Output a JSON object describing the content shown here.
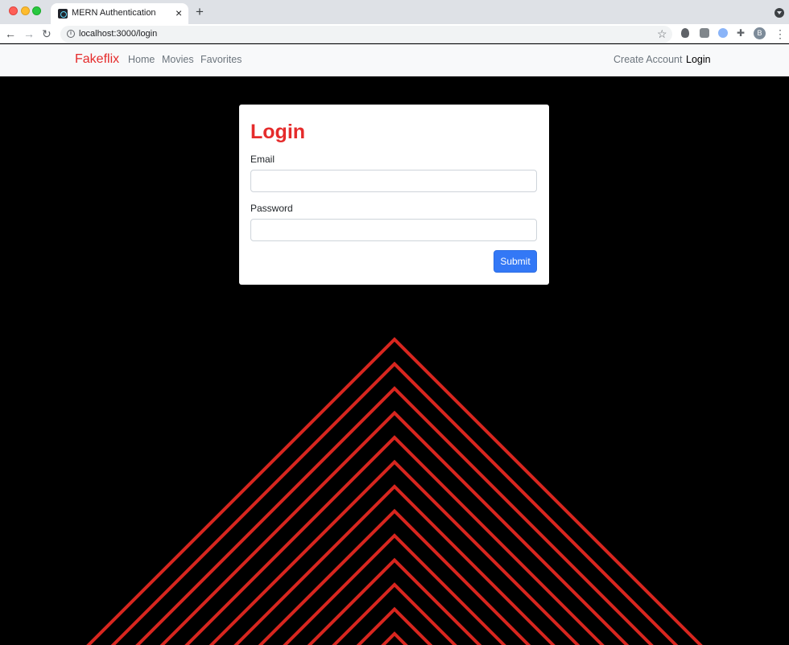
{
  "browser": {
    "tab_title": "MERN Authentication",
    "url": "localhost:3000/login",
    "profile_initial": "B",
    "icons": {
      "back": "back-arrow-icon",
      "forward": "forward-arrow-icon",
      "reload": "reload-icon",
      "bookmark": "star-icon",
      "extensions": "puzzle-icon",
      "menu": "kebab-menu-icon"
    }
  },
  "navbar": {
    "brand": "Fakeflix",
    "links": [
      "Home",
      "Movies",
      "Favorites"
    ],
    "right_links": [
      "Create Account",
      "Login"
    ],
    "brand_color": "#e52b2b"
  },
  "login_form": {
    "title": "Login",
    "email_label": "Email",
    "email_value": "",
    "password_label": "Password",
    "password_value": "",
    "submit_label": "Submit",
    "submit_color": "#3378f6"
  },
  "background": {
    "color": "#000000",
    "pattern_color": "#d8261f"
  }
}
